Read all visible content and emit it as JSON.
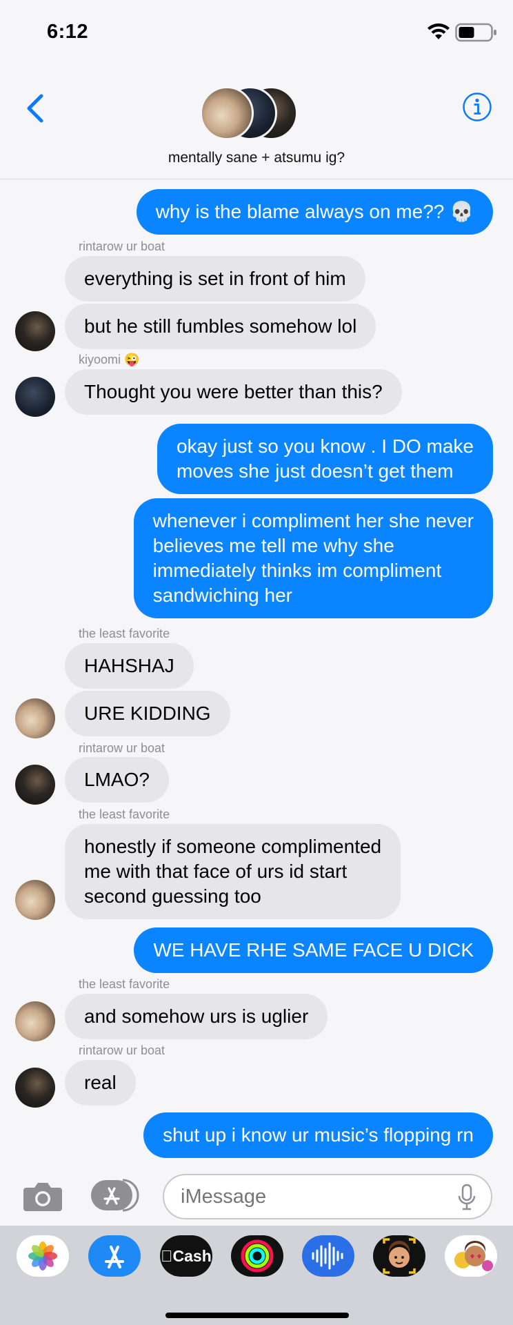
{
  "status_bar": {
    "time": "6:12"
  },
  "header": {
    "group_title": "mentally sane + atsumu ig?"
  },
  "messages": [
    {
      "text": "why is the blame always on me?? 💀"
    },
    {
      "sender": "rintarow ur boat"
    },
    {
      "text": "everything is set in front of him"
    },
    {
      "text": "but he still fumbles somehow lol"
    },
    {
      "sender": "kiyoomi 😜"
    },
    {
      "text": "Thought you were better than this?"
    },
    {
      "text": "okay just so you know . I DO make\nmoves she just doesn’t get them"
    },
    {
      "text": "whenever i compliment her she never\nbelieves me tell me why she\nimmediately thinks im compliment\nsandwiching her"
    },
    {
      "sender": "the least favorite"
    },
    {
      "text": "HAHSHAJ"
    },
    {
      "text": "URE KIDDING"
    },
    {
      "sender": "rintarow ur boat"
    },
    {
      "text": "LMAO?"
    },
    {
      "sender": "the least favorite"
    },
    {
      "text": "honestly if someone complimented\nme with that face of urs id start\nsecond guessing too"
    },
    {
      "text": "WE HAVE RHE SAME FACE U DICK"
    },
    {
      "sender": "the least favorite"
    },
    {
      "text": "and somehow urs is uglier"
    },
    {
      "sender": "rintarow ur boat"
    },
    {
      "text": "real"
    },
    {
      "text": "shut up i know ur music’s flopping rn"
    }
  ],
  "input": {
    "placeholder": "iMessage"
  },
  "app_drawer": {
    "cash_label": "Cash",
    "items": [
      "photos-icon",
      "app-store-icon",
      "apple-cash-icon",
      "fitness-icon",
      "audio-message-icon",
      "memoji-icon",
      "memoji-stickers-icon"
    ]
  },
  "colors": {
    "outgoing": "#0a84ff",
    "incoming": "#e5e5ea",
    "accent": "#0a7aff"
  }
}
